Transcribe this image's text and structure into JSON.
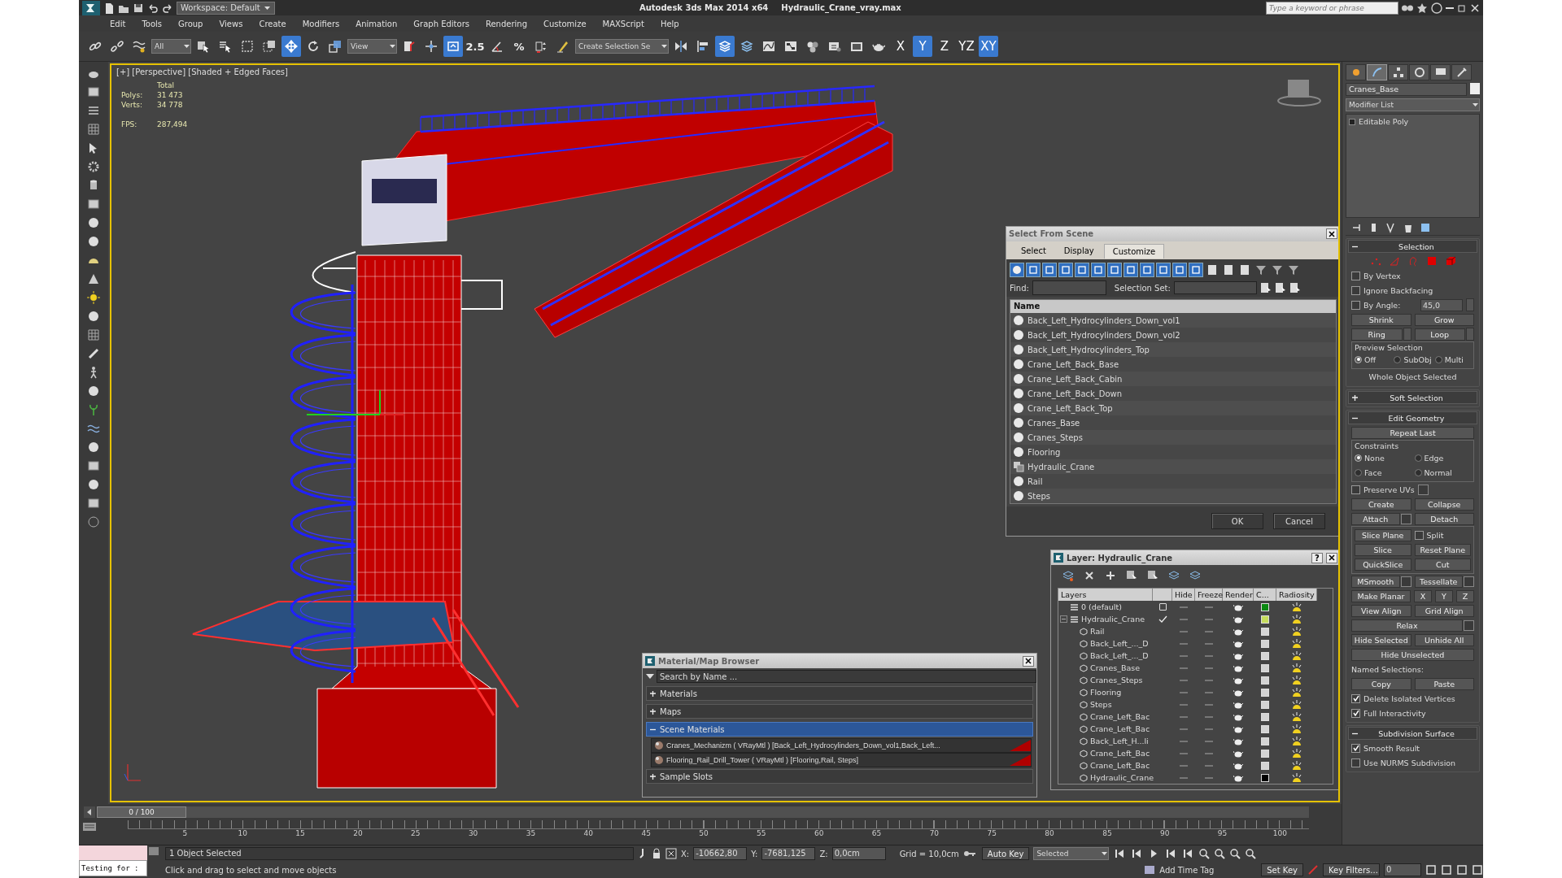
{
  "window": {
    "app_title": "Autodesk 3ds Max  2014 x64",
    "file_title": "Hydraulic_Crane_vray.max",
    "workspace": "Workspace: Default",
    "search": {
      "placeholder": "Type a keyword or phrase"
    }
  },
  "menu": [
    "Edit",
    "Tools",
    "Group",
    "Views",
    "Create",
    "Modifiers",
    "Animation",
    "Graph Editors",
    "Rendering",
    "Customize",
    "MAXScript",
    "Help"
  ],
  "toolbar": [
    {
      "kind": "link",
      "selected": false
    },
    {
      "kind": "unlink",
      "selected": false
    },
    {
      "kind": "bind",
      "selected": false
    },
    {
      "kind": "dropdown",
      "value": "All"
    },
    {
      "kind": "select",
      "selected": false
    },
    {
      "kind": "select_by_name",
      "selected": false
    },
    {
      "kind": "region",
      "selected": false
    },
    {
      "kind": "window_crossing",
      "selected": false
    },
    {
      "kind": "move",
      "selected": true
    },
    {
      "kind": "rotate",
      "selected": false
    },
    {
      "kind": "scale",
      "selected": false
    },
    {
      "kind": "dropdown",
      "value": "View"
    },
    {
      "kind": "pivot",
      "selected": false
    },
    {
      "kind": "manipulate",
      "selected": false
    },
    {
      "kind": "shortcut_override",
      "selected": true
    },
    {
      "kind": "snap",
      "label": "2.5",
      "selected": false
    },
    {
      "kind": "angle_snap",
      "selected": false
    },
    {
      "kind": "percent_snap",
      "label": "%",
      "selected": false
    },
    {
      "kind": "spinner_snap",
      "selected": false
    },
    {
      "kind": "named_sets",
      "selected": false
    },
    {
      "kind": "dropdown",
      "value": "Create Selection Se"
    },
    {
      "kind": "mirror",
      "selected": false
    },
    {
      "kind": "align",
      "selected": false
    },
    {
      "kind": "scene_explorer",
      "selected": true
    },
    {
      "kind": "layer_manager",
      "selected": false
    },
    {
      "kind": "curve_editor",
      "selected": false
    },
    {
      "kind": "schematic",
      "selected": false
    },
    {
      "kind": "material_editor",
      "selected": false
    },
    {
      "kind": "render_setup",
      "selected": false
    },
    {
      "kind": "frame_window",
      "selected": false
    },
    {
      "kind": "render",
      "selected": false
    },
    {
      "kind": "axis",
      "label": "X",
      "selected": false
    },
    {
      "kind": "axis",
      "label": "Y",
      "selected": true
    },
    {
      "kind": "axis",
      "label": "Z",
      "selected": false
    },
    {
      "kind": "axis",
      "label": "YZ",
      "selected": false
    },
    {
      "kind": "axis",
      "label": "XY",
      "selected": true
    }
  ],
  "viewport": {
    "label": "[+] [Perspective] [Shaded + Edged Faces]",
    "stats_heading": "Total",
    "stats": [
      {
        "label": "Polys:",
        "value": "31 473"
      },
      {
        "label": "Verts:",
        "value": "34 778"
      }
    ],
    "fps_label": "FPS:",
    "fps_value": "287,494"
  },
  "select_from_scene": {
    "title": "Select From Scene",
    "tabs": [
      {
        "label": "Select",
        "selected": false
      },
      {
        "label": "Display",
        "selected": false
      },
      {
        "label": "Customize",
        "selected": true
      }
    ],
    "find_label": "Find:",
    "selection_set_label": "Selection Set:",
    "column": "Name",
    "objects": [
      {
        "name": "Back_Left_Hydrocylinders_Down_vol1",
        "kind": "geometry"
      },
      {
        "name": "Back_Left_Hydrocylinders_Down_vol2",
        "kind": "geometry"
      },
      {
        "name": "Back_Left_Hydrocylinders_Top",
        "kind": "geometry"
      },
      {
        "name": "Crane_Left_Back_Base",
        "kind": "geometry"
      },
      {
        "name": "Crane_Left_Back_Cabin",
        "kind": "geometry"
      },
      {
        "name": "Crane_Left_Back_Down",
        "kind": "geometry"
      },
      {
        "name": "Crane_Left_Back_Top",
        "kind": "geometry"
      },
      {
        "name": "Cranes_Base",
        "kind": "geometry"
      },
      {
        "name": "Cranes_Steps",
        "kind": "geometry"
      },
      {
        "name": "Flooring",
        "kind": "geometry"
      },
      {
        "name": "Hydraulic_Crane",
        "kind": "group"
      },
      {
        "name": "Rail",
        "kind": "geometry"
      },
      {
        "name": "Steps",
        "kind": "geometry"
      }
    ],
    "buttons": [
      "OK",
      "Cancel"
    ]
  },
  "layer_manager": {
    "title": "Layer: Hydraulic_Crane",
    "help_button": "?",
    "columns": [
      "Layers",
      "Hide",
      "Freeze",
      "Render",
      "C...",
      "Radiosity"
    ],
    "layers": [
      {
        "name": "0 (default)",
        "current": false,
        "color": "#0b8a12"
      },
      {
        "name": "Hydraulic_Crane",
        "current": true,
        "expanded": true,
        "color": "#c6dc5c",
        "children": [
          {
            "name": "Rail",
            "color": "#d4d4d4"
          },
          {
            "name": "Back_Left_..._D",
            "color": "#d4d4d4"
          },
          {
            "name": "Back_Left_..._D",
            "color": "#d4d4d4"
          },
          {
            "name": "Cranes_Base",
            "color": "#d4d4d4"
          },
          {
            "name": "Cranes_Steps",
            "color": "#d4d4d4"
          },
          {
            "name": "Flooring",
            "color": "#d4d4d4"
          },
          {
            "name": "Steps",
            "color": "#d4d4d4"
          },
          {
            "name": "Crane_Left_Bac",
            "color": "#d4d4d4"
          },
          {
            "name": "Crane_Left_Bac",
            "color": "#d4d4d4"
          },
          {
            "name": "Back_Left_H...li",
            "color": "#d4d4d4"
          },
          {
            "name": "Crane_Left_Bac",
            "color": "#d4d4d4"
          },
          {
            "name": "Crane_Left_Bac",
            "color": "#d4d4d4"
          },
          {
            "name": "Hydraulic_Crane",
            "color": "#000000"
          }
        ]
      }
    ]
  },
  "material_browser": {
    "title": "Material/Map Browser",
    "search": {
      "placeholder": "Search by Name ..."
    },
    "groups": [
      {
        "label": "Materials",
        "expanded": false
      },
      {
        "label": "Maps",
        "expanded": false
      },
      {
        "label": "Scene Materials",
        "expanded": true,
        "items": [
          "Cranes_Mechanizm ( VRayMtl ) [Back_Left_Hydrocylinders_Down_vol1,Back_Left...",
          "Flooring_Rail_Drill_Tower ( VRayMtl ) [Flooring,Rail, Steps]"
        ]
      },
      {
        "label": "Sample Slots",
        "expanded": false
      }
    ]
  },
  "command_panel": {
    "tabs": [
      {
        "selected": false
      },
      {
        "selected": true
      },
      {
        "selected": false
      },
      {
        "selected": false
      },
      {
        "selected": false
      },
      {
        "selected": false
      }
    ],
    "object_name": "Cranes_Base",
    "modifier_list": "Modifier List",
    "stack": [
      "Editable Poly"
    ],
    "rollouts": [
      {
        "title": "Selection",
        "expanded": true,
        "rows": [
          [
            {
              "kind": "subobject_icons"
            }
          ],
          [
            {
              "kind": "check",
              "label": "By Vertex",
              "checked": false
            }
          ],
          [
            {
              "kind": "check",
              "label": "Ignore Backfacing",
              "checked": false
            }
          ],
          [
            {
              "kind": "check",
              "label": "By Angle:",
              "checked": false
            },
            {
              "kind": "spinner",
              "value": "45,0"
            }
          ],
          [
            {
              "kind": "button",
              "label": "Shrink"
            },
            {
              "kind": "button",
              "label": "Grow"
            }
          ],
          [
            {
              "kind": "button",
              "label": "Ring",
              "spinner": true
            },
            {
              "kind": "button",
              "label": "Loop",
              "spinner": true
            }
          ],
          [
            {
              "kind": "group",
              "title": "Preview Selection",
              "rows": [
                [
                  {
                    "kind": "radio",
                    "label": "Off",
                    "selected": true
                  },
                  {
                    "kind": "radio",
                    "label": "SubObj",
                    "selected": false
                  },
                  {
                    "kind": "radio",
                    "label": "Multi",
                    "selected": false
                  }
                ]
              ]
            }
          ],
          [
            {
              "kind": "note",
              "label": "Whole Object Selected"
            }
          ]
        ]
      },
      {
        "title": "Soft Selection",
        "expanded": false
      },
      {
        "title": "Edit Geometry",
        "expanded": true,
        "rows": [
          [
            {
              "kind": "button",
              "label": "Repeat Last"
            }
          ],
          [
            {
              "kind": "group",
              "title": "Constraints",
              "rows": [
                [
                  {
                    "kind": "radio",
                    "label": "None",
                    "selected": true
                  },
                  {
                    "kind": "radio",
                    "label": "Edge",
                    "selected": false
                  }
                ],
                [
                  {
                    "kind": "radio",
                    "label": "Face",
                    "selected": false
                  },
                  {
                    "kind": "radio",
                    "label": "Normal",
                    "selected": false
                  }
                ]
              ]
            }
          ],
          [
            {
              "kind": "check",
              "label": "Preserve UVs",
              "checked": false,
              "settings": true
            }
          ],
          [
            {
              "kind": "button",
              "label": "Create"
            },
            {
              "kind": "button",
              "label": "Collapse"
            }
          ],
          [
            {
              "kind": "button",
              "label": "Attach",
              "settings": true
            },
            {
              "kind": "button",
              "label": "Detach"
            }
          ],
          [
            {
              "kind": "group",
              "rows": [
                [
                  {
                    "kind": "button",
                    "label": "Slice Plane"
                  },
                  {
                    "kind": "check",
                    "label": "Split",
                    "checked": false
                  }
                ],
                [
                  {
                    "kind": "button",
                    "label": "Slice"
                  },
                  {
                    "kind": "button",
                    "label": "Reset Plane"
                  }
                ],
                [
                  {
                    "kind": "button",
                    "label": "QuickSlice"
                  },
                  {
                    "kind": "button",
                    "label": "Cut"
                  }
                ]
              ]
            }
          ],
          [
            {
              "kind": "button",
              "label": "MSmooth",
              "settings": true
            },
            {
              "kind": "button",
              "label": "Tessellate",
              "settings": true
            }
          ],
          [
            {
              "kind": "button",
              "label": "Make Planar"
            },
            {
              "kind": "small",
              "label": "X"
            },
            {
              "kind": "small",
              "label": "Y"
            },
            {
              "kind": "small",
              "label": "Z"
            }
          ],
          [
            {
              "kind": "button",
              "label": "View Align"
            },
            {
              "kind": "button",
              "label": "Grid Align"
            }
          ],
          [
            {
              "kind": "button",
              "label": "Relax",
              "settings": true
            }
          ],
          [
            {
              "kind": "button",
              "label": "Hide Selected"
            },
            {
              "kind": "button",
              "label": "Unhide All"
            }
          ],
          [
            {
              "kind": "button",
              "label": "Hide Unselected"
            }
          ],
          [
            {
              "kind": "label",
              "label": "Named Selections:"
            }
          ],
          [
            {
              "kind": "button",
              "label": "Copy"
            },
            {
              "kind": "button",
              "label": "Paste"
            }
          ],
          [
            {
              "kind": "check",
              "label": "Delete Isolated Vertices",
              "checked": true
            }
          ],
          [
            {
              "kind": "check",
              "label": "Full Interactivity",
              "checked": true
            }
          ]
        ]
      },
      {
        "title": "Subdivision Surface",
        "expanded": true,
        "rows": [
          [
            {
              "kind": "check",
              "label": "Smooth Result",
              "checked": true
            }
          ],
          [
            {
              "kind": "check",
              "label": "Use NURMS Subdivision",
              "checked": false
            }
          ]
        ]
      }
    ]
  },
  "timeline": {
    "frame_counter": "0 / 100",
    "level": 0,
    "ticks": [
      "5",
      "10",
      "15",
      "20",
      "25",
      "30",
      "35",
      "40",
      "45",
      "50",
      "55",
      "60",
      "65",
      "70",
      "75",
      "80",
      "85",
      "90",
      "95",
      "100"
    ]
  },
  "status_bar": {
    "listener": "Testing for :",
    "selection": "1 Object Selected",
    "prompt": "Click and drag to select and move objects",
    "x_label": "X:",
    "x_value": "-10662,80",
    "y_label": "Y:",
    "y_value": "-7681,125",
    "z_label": "Z:",
    "z_value": "0,0cm",
    "grid": "Grid = 10,0cm",
    "add_time_tag": "Add Time Tag",
    "auto_key": "Auto Key",
    "set_key": "Set Key",
    "key_mode": "Selected",
    "key_filters": "Key Filters...",
    "frame": "0"
  }
}
